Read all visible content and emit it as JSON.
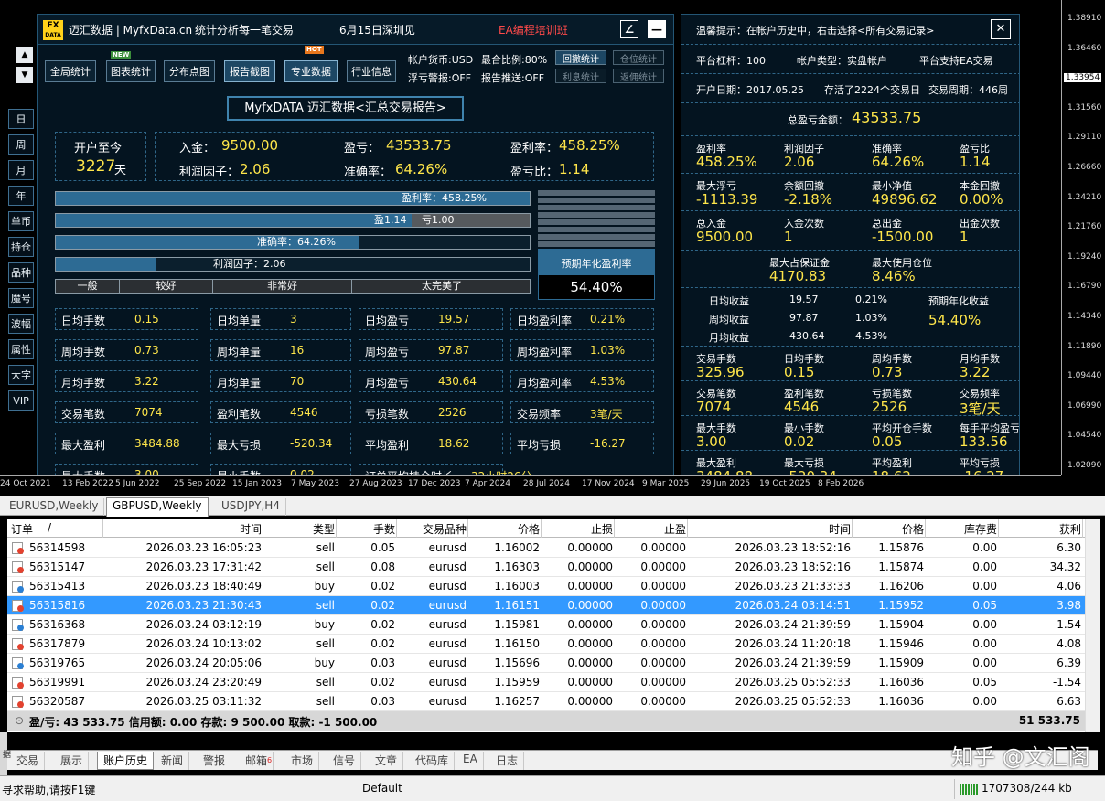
{
  "chart": {
    "yticks": [
      "1.38910",
      "1.36460",
      "1.33954",
      "1.31560",
      "1.29110",
      "1.26660",
      "1.24210",
      "1.21760",
      "1.19240",
      "1.16790",
      "1.14340",
      "1.11890",
      "1.09440",
      "1.06990",
      "1.04540",
      "1.02090"
    ],
    "current_price": "1.33954",
    "xticks": [
      "24 Oct 2021",
      "13 Feb 2022",
      "5 Jun 2022",
      "25 Sep 2022",
      "15 Jan 2023",
      "7 May 2023",
      "27 Aug 2023",
      "17 Dec 2023",
      "7 Apr 2024",
      "28 Jul 2024",
      "17 Nov 2024",
      "9 Mar 2025",
      "29 Jun 2025",
      "19 Oct 2025",
      "8 Feb 2026"
    ]
  },
  "side": {
    "up_arrow": "▲",
    "down_arrow": "▼",
    "buttons": [
      "日",
      "周",
      "月",
      "年",
      "单币",
      "持仓",
      "品种",
      "魔号",
      "波幅",
      "属性",
      "大字",
      "VIP"
    ]
  },
  "main": {
    "logo_text_1": "FX",
    "logo_text_2": "DATA",
    "title": "迈汇数据 | MyfxData.cn",
    "slogan": "统计分析每一笔交易",
    "event": "6月15日深圳见",
    "training": "EA编程培训班",
    "edit_icon": "∠",
    "min_icon": "—",
    "nav": [
      "全局统计",
      "图表统计",
      "分布点图",
      "报告截图",
      "专业数据",
      "行业信息"
    ],
    "new_badge": "NEW",
    "hot_badge": "HOT",
    "info": {
      "currency": "帐户货币:USD",
      "margin_ratio": "最合比例:80%",
      "float_alert": "浮亏警报:OFF",
      "report_push": "报告推送:OFF"
    },
    "small_buttons": [
      "回撤统计",
      "仓位统计",
      "利息统计",
      "返佣统计"
    ],
    "report_title": "MyfxDATA 迈汇数据<汇总交易报告>",
    "since_open_label": "开户至今",
    "since_open_value": "3227",
    "since_open_unit": "天",
    "summary": {
      "deposit_label": "入金：",
      "deposit_value": "9500.00",
      "profit_label": "盈亏：",
      "profit_value": "43533.75",
      "return_label": "盈利率：",
      "return_value": "458.25%",
      "pf_label": "利润因子：",
      "pf_value": "2.06",
      "accuracy_label": "准确率：",
      "accuracy_value": "64.26%",
      "pl_ratio_label": "盈亏比：",
      "pl_ratio_value": "1.14"
    },
    "bars": {
      "return_text": "盈利率：458.25%",
      "return_fraction": 1.0,
      "win_text": "盈1.14",
      "loss_text": "亏1.00",
      "win_fraction": 0.75,
      "accuracy_text": "准确率：64.26%",
      "accuracy_fraction": 0.64,
      "pf_text": "利润因子：2.06",
      "pf_fraction": 0.21
    },
    "rating": [
      "一般",
      "较好",
      "非常好",
      "太完美了"
    ],
    "annual_label": "预期年化盈利率",
    "annual_value": "54.40%",
    "stats": [
      [
        "日均手数",
        "0.15",
        "日均单量",
        "3",
        "日均盈亏",
        "19.57",
        "日均盈利率",
        "0.21%"
      ],
      [
        "周均手数",
        "0.73",
        "周均单量",
        "16",
        "周均盈亏",
        "97.87",
        "周均盈利率",
        "1.03%"
      ],
      [
        "月均手数",
        "3.22",
        "月均单量",
        "70",
        "月均盈亏",
        "430.64",
        "月均盈利率",
        "4.53%"
      ],
      [
        "交易笔数",
        "7074",
        "盈利笔数",
        "4546",
        "亏损笔数",
        "2526",
        "交易频率",
        "3笔/天"
      ],
      [
        "最大盈利",
        "3484.88",
        "最大亏损",
        "-520.34",
        "平均盈利",
        "18.62",
        "平均亏损",
        "-16.27"
      ],
      [
        "最大手数",
        "3.00",
        "最小手数",
        "0.02",
        "订单平均持仓时长",
        "32小时26分",
        "",
        " "
      ]
    ]
  },
  "right": {
    "tip": "温馨提示：在帐户历史中，右击选择<所有交易记录>",
    "close_icon": "✕",
    "leverage": "平台杠杆：100",
    "acct_type": "帐户类型：实盘帐户",
    "ea_support": "平台支持EA交易",
    "open_date": "开户日期：2017.05.25",
    "days_alive": "存活了2224个交易日",
    "trade_cycle": "交易周期：446周",
    "total_label": "总盈亏金额：",
    "total_value": "43533.75",
    "g1": [
      [
        "盈利率",
        "458.25%"
      ],
      [
        "利润因子",
        "2.06"
      ],
      [
        "准确率",
        "64.26%"
      ],
      [
        "盈亏比",
        "1.14"
      ]
    ],
    "g2": [
      [
        "最大浮亏",
        "-1113.39"
      ],
      [
        "余额回撤",
        "-2.18%"
      ],
      [
        "最小净值",
        "49896.62"
      ],
      [
        "本金回撤",
        "0.00%"
      ]
    ],
    "g3": [
      [
        "总入金",
        "9500.00"
      ],
      [
        "入金次数",
        "1"
      ],
      [
        "总出金",
        "-1500.00"
      ],
      [
        "出金次数",
        "1"
      ]
    ],
    "g4": [
      [
        "最大占保证金",
        "4170.83"
      ],
      [
        "最大使用仓位",
        "8.46%"
      ]
    ],
    "income": [
      [
        "日均收益",
        "19.57",
        "0.21%"
      ],
      [
        "周均收益",
        "97.87",
        "1.03%"
      ],
      [
        "月均收益",
        "430.64",
        "4.53%"
      ]
    ],
    "annual_label": "预期年化收益",
    "annual_value": "54.40%",
    "g5": [
      [
        "交易手数",
        "325.96"
      ],
      [
        "日均手数",
        "0.15"
      ],
      [
        "周均手数",
        "0.73"
      ],
      [
        "月均手数",
        "3.22"
      ]
    ],
    "g6": [
      [
        "交易笔数",
        "7074"
      ],
      [
        "盈利笔数",
        "4546"
      ],
      [
        "亏损笔数",
        "2526"
      ],
      [
        "交易频率",
        "3笔/天"
      ]
    ],
    "g7": [
      [
        "最大手数",
        "3.00"
      ],
      [
        "最小手数",
        "0.02"
      ],
      [
        "平均开仓手数",
        "0.05"
      ],
      [
        "每手平均盈亏",
        "133.56"
      ]
    ],
    "g8": [
      [
        "最大盈利",
        "3484.88"
      ],
      [
        "最大亏损",
        "-520.34"
      ],
      [
        "平均盈利",
        "18.62"
      ],
      [
        "平均亏损",
        "-16.27"
      ]
    ]
  },
  "chart_tabs": [
    "EURUSD,Weekly",
    "GBPUSD,Weekly",
    "USDJPY,H4"
  ],
  "table": {
    "headers": [
      "订单",
      "/",
      "时间",
      "类型",
      "手数",
      "交易品种",
      "价格",
      "止损",
      "止盈",
      "时间",
      "价格",
      "库存费",
      "获利"
    ],
    "rows": [
      [
        "56314598",
        "2026.03.23 16:05:23",
        "sell",
        "0.05",
        "eurusd",
        "1.16002",
        "0.00000",
        "0.00000",
        "2026.03.23 18:52:16",
        "1.15876",
        "0.00",
        "6.30"
      ],
      [
        "56315147",
        "2026.03.23 17:31:42",
        "sell",
        "0.08",
        "eurusd",
        "1.16303",
        "0.00000",
        "0.00000",
        "2026.03.23 18:52:16",
        "1.15874",
        "0.00",
        "34.32"
      ],
      [
        "56315413",
        "2026.03.23 18:40:49",
        "buy",
        "0.02",
        "eurusd",
        "1.16003",
        "0.00000",
        "0.00000",
        "2026.03.23 21:33:33",
        "1.16206",
        "0.00",
        "4.06"
      ],
      [
        "56315816",
        "2026.03.23 21:30:43",
        "sell",
        "0.02",
        "eurusd",
        "1.16151",
        "0.00000",
        "0.00000",
        "2026.03.24 03:14:51",
        "1.15952",
        "0.05",
        "3.98"
      ],
      [
        "56316368",
        "2026.03.24 03:12:19",
        "buy",
        "0.02",
        "eurusd",
        "1.15981",
        "0.00000",
        "0.00000",
        "2026.03.24 21:39:59",
        "1.15904",
        "0.00",
        "-1.54"
      ],
      [
        "56317879",
        "2026.03.24 10:13:02",
        "sell",
        "0.02",
        "eurusd",
        "1.16150",
        "0.00000",
        "0.00000",
        "2026.03.24 11:20:18",
        "1.15946",
        "0.00",
        "4.08"
      ],
      [
        "56319765",
        "2026.03.24 20:05:06",
        "buy",
        "0.03",
        "eurusd",
        "1.15696",
        "0.00000",
        "0.00000",
        "2026.03.24 21:39:59",
        "1.15909",
        "0.00",
        "6.39"
      ],
      [
        "56319991",
        "2026.03.24 23:20:49",
        "sell",
        "0.02",
        "eurusd",
        "1.15959",
        "0.00000",
        "0.00000",
        "2026.03.25 05:52:33",
        "1.16036",
        "0.05",
        "-1.54"
      ],
      [
        "56320587",
        "2026.03.25 03:11:32",
        "sell",
        "0.03",
        "eurusd",
        "1.16257",
        "0.00000",
        "0.00000",
        "2026.03.25 05:52:33",
        "1.16036",
        "0.00",
        "6.63"
      ]
    ],
    "summary": "盈/亏: 43 533.75  信用额: 0.00  存款: 9 500.00  取款: -1 500.00",
    "summary_total": "51 533.75",
    "sum_marker": "⊙"
  },
  "terminal_tabs": [
    "交易",
    "展示",
    "账户历史",
    "新闻",
    "警报",
    "邮箱",
    "市场",
    "信号",
    "文章",
    "代码库",
    "EA",
    "日志"
  ],
  "mail_count": "6",
  "status": {
    "help": "寻求帮助,请按F1键",
    "profile": "Default",
    "traffic": "1707308/244 kb"
  },
  "watermark": "知乎 @文汇阁",
  "side_letters": "据"
}
